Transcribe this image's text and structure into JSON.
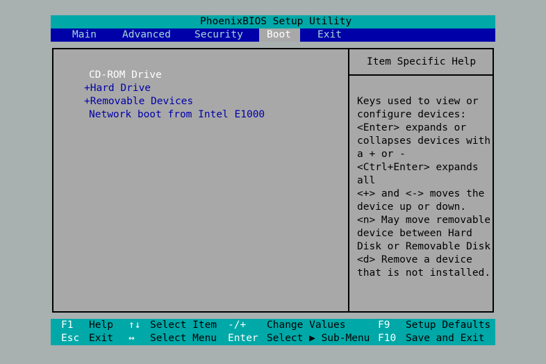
{
  "title": "PhoenixBIOS Setup Utility",
  "menu": [
    {
      "label": "Main"
    },
    {
      "label": "Advanced"
    },
    {
      "label": "Security"
    },
    {
      "label": "Boot"
    },
    {
      "label": "Exit"
    }
  ],
  "active_menu": "Boot",
  "boot_items": [
    {
      "label": "CD-ROM Drive",
      "prefix": "",
      "selected": true
    },
    {
      "label": "Hard Drive",
      "prefix": "+",
      "selected": false
    },
    {
      "label": "Removable Devices",
      "prefix": "+",
      "selected": false
    },
    {
      "label": "Network boot from Intel E1000",
      "prefix": "",
      "selected": false
    }
  ],
  "help": {
    "title": "Item Specific Help",
    "lines": [
      "Keys used to view or",
      "configure devices:",
      "<Enter> expands or",
      "collapses devices with",
      "a + or -",
      "<Ctrl+Enter> expands",
      "all",
      "<+> and <-> moves the",
      "device up or down.",
      "<n> May move removable",
      "device between Hard",
      "Disk or Removable Disk",
      "<d> Remove a device",
      "that is not installed."
    ]
  },
  "footer": {
    "row1": [
      {
        "key": "F1",
        "desc": "Help"
      },
      {
        "key": "↑↓",
        "desc": "Select Item"
      },
      {
        "key": "-/+",
        "desc": "Change Values"
      },
      {
        "key": "F9",
        "desc": "Setup Defaults"
      }
    ],
    "row2": [
      {
        "key": "Esc",
        "desc": "Exit"
      },
      {
        "key": "↔",
        "desc": "Select Menu"
      },
      {
        "key": "Enter",
        "desc": "Select ▶ Sub-Menu"
      },
      {
        "key": "F10",
        "desc": "Save and Exit"
      }
    ]
  },
  "colors": {
    "cyan": "#00a8a8",
    "blue": "#0000a8",
    "gray": "#a8a8a8",
    "white": "#ffffff"
  }
}
